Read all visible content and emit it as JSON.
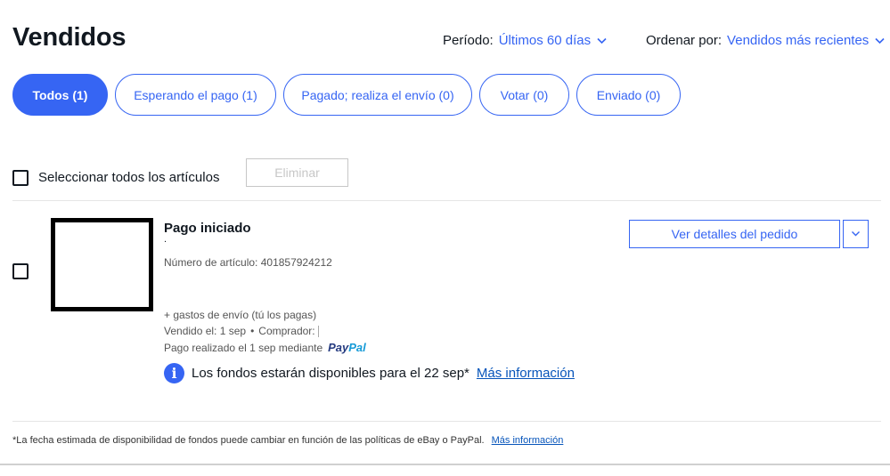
{
  "page": {
    "title": "Vendidos"
  },
  "sort": {
    "period_label": "Período:",
    "period_value": "Últimos 60 días",
    "order_label": "Ordenar por:",
    "order_value": "Vendidos más recientes"
  },
  "tabs": [
    {
      "label": "Todos (1)",
      "active": true
    },
    {
      "label": "Esperando el pago (1)",
      "active": false
    },
    {
      "label": "Pagado; realiza el envío (0)",
      "active": false
    },
    {
      "label": "Votar (0)",
      "active": false
    },
    {
      "label": "Enviado (0)",
      "active": false
    }
  ],
  "actions": {
    "select_all_label": "Seleccionar todos los artículos",
    "delete_label": "Eliminar"
  },
  "item": {
    "status": "Pago iniciado",
    "dot": ".",
    "number": "Número de artículo: 401857924212",
    "shipping": "+ gastos de envío (tú los pagas)",
    "sold": "Vendido el: 1 sep",
    "separator": "•",
    "buyer_label": "Comprador:",
    "paid": "Pago realizado el 1 sep mediante",
    "paypal_pay": "Pay",
    "paypal_pal": "Pal",
    "details_button": "Ver detalles del pedido"
  },
  "info": {
    "icon_glyph": "i",
    "message": "Los fondos estarán disponibles para el 22 sep*",
    "link": "Más información"
  },
  "footer": {
    "note": "*La fecha estimada de disponibilidad de fondos puede cambiar en función de las políticas de eBay o PayPal.",
    "link": "Más información"
  },
  "colors": {
    "accent": "#3665f3",
    "link": "#0654ba",
    "text": "#111820",
    "disabled": "#c7c7c7"
  },
  "icons": {
    "dropdown": "chevron-down-icon",
    "info": "info-icon"
  }
}
